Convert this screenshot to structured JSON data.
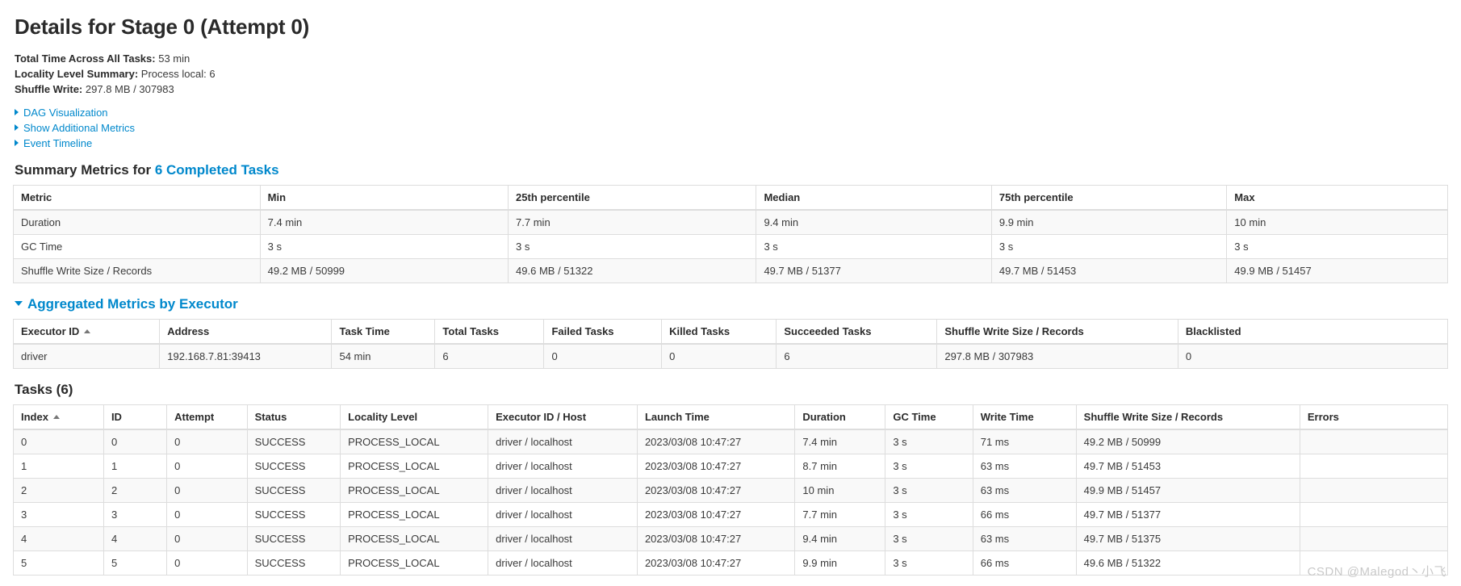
{
  "page": {
    "title": "Details for Stage 0 (Attempt 0)"
  },
  "summary": [
    {
      "label": "Total Time Across All Tasks:",
      "value": "53 min"
    },
    {
      "label": "Locality Level Summary:",
      "value": "Process local: 6"
    },
    {
      "label": "Shuffle Write:",
      "value": "297.8 MB / 307983"
    }
  ],
  "toggles": [
    {
      "label": "DAG Visualization",
      "icon": "chevron-right-icon",
      "expanded": false
    },
    {
      "label": "Show Additional Metrics",
      "icon": "chevron-right-icon",
      "expanded": false
    },
    {
      "label": "Event Timeline",
      "icon": "chevron-right-icon",
      "expanded": false
    }
  ],
  "summary_metrics": {
    "heading_prefix": "Summary Metrics for ",
    "heading_link": "6 Completed Tasks",
    "columns": [
      "Metric",
      "Min",
      "25th percentile",
      "Median",
      "75th percentile",
      "Max"
    ],
    "rows": [
      [
        "Duration",
        "7.4 min",
        "7.7 min",
        "9.4 min",
        "9.9 min",
        "10 min"
      ],
      [
        "GC Time",
        "3 s",
        "3 s",
        "3 s",
        "3 s",
        "3 s"
      ],
      [
        "Shuffle Write Size / Records",
        "49.2 MB / 50999",
        "49.6 MB / 51322",
        "49.7 MB / 51377",
        "49.7 MB / 51453",
        "49.9 MB / 51457"
      ]
    ]
  },
  "aggregated_metrics": {
    "heading": "Aggregated Metrics by Executor",
    "columns": [
      "Executor ID",
      "Address",
      "Task Time",
      "Total Tasks",
      "Failed Tasks",
      "Killed Tasks",
      "Succeeded Tasks",
      "Shuffle Write Size / Records",
      "Blacklisted"
    ],
    "sorted_column": "Executor ID",
    "rows": [
      [
        "driver",
        "192.168.7.81:39413",
        "54 min",
        "6",
        "0",
        "0",
        "6",
        "297.8 MB / 307983",
        "0"
      ]
    ]
  },
  "tasks": {
    "heading": "Tasks (6)",
    "columns": [
      "Index",
      "ID",
      "Attempt",
      "Status",
      "Locality Level",
      "Executor ID / Host",
      "Launch Time",
      "Duration",
      "GC Time",
      "Write Time",
      "Shuffle Write Size / Records",
      "Errors"
    ],
    "sorted_column": "Index",
    "rows": [
      [
        "0",
        "0",
        "0",
        "SUCCESS",
        "PROCESS_LOCAL",
        "driver / localhost",
        "2023/03/08 10:47:27",
        "7.4 min",
        "3 s",
        "71 ms",
        "49.2 MB / 50999",
        ""
      ],
      [
        "1",
        "1",
        "0",
        "SUCCESS",
        "PROCESS_LOCAL",
        "driver / localhost",
        "2023/03/08 10:47:27",
        "8.7 min",
        "3 s",
        "63 ms",
        "49.7 MB / 51453",
        ""
      ],
      [
        "2",
        "2",
        "0",
        "SUCCESS",
        "PROCESS_LOCAL",
        "driver / localhost",
        "2023/03/08 10:47:27",
        "10 min",
        "3 s",
        "63 ms",
        "49.9 MB / 51457",
        ""
      ],
      [
        "3",
        "3",
        "0",
        "SUCCESS",
        "PROCESS_LOCAL",
        "driver / localhost",
        "2023/03/08 10:47:27",
        "7.7 min",
        "3 s",
        "66 ms",
        "49.7 MB / 51377",
        ""
      ],
      [
        "4",
        "4",
        "0",
        "SUCCESS",
        "PROCESS_LOCAL",
        "driver / localhost",
        "2023/03/08 10:47:27",
        "9.4 min",
        "3 s",
        "63 ms",
        "49.7 MB / 51375",
        ""
      ],
      [
        "5",
        "5",
        "0",
        "SUCCESS",
        "PROCESS_LOCAL",
        "driver / localhost",
        "2023/03/08 10:47:27",
        "9.9 min",
        "3 s",
        "66 ms",
        "49.6 MB / 51322",
        ""
      ]
    ]
  },
  "watermark": "CSDN @Malegod丶小飞",
  "colors": {
    "link": "#0088cc",
    "text": "#333333",
    "row_alt": "#f9f9f9",
    "border": "#dddddd"
  }
}
